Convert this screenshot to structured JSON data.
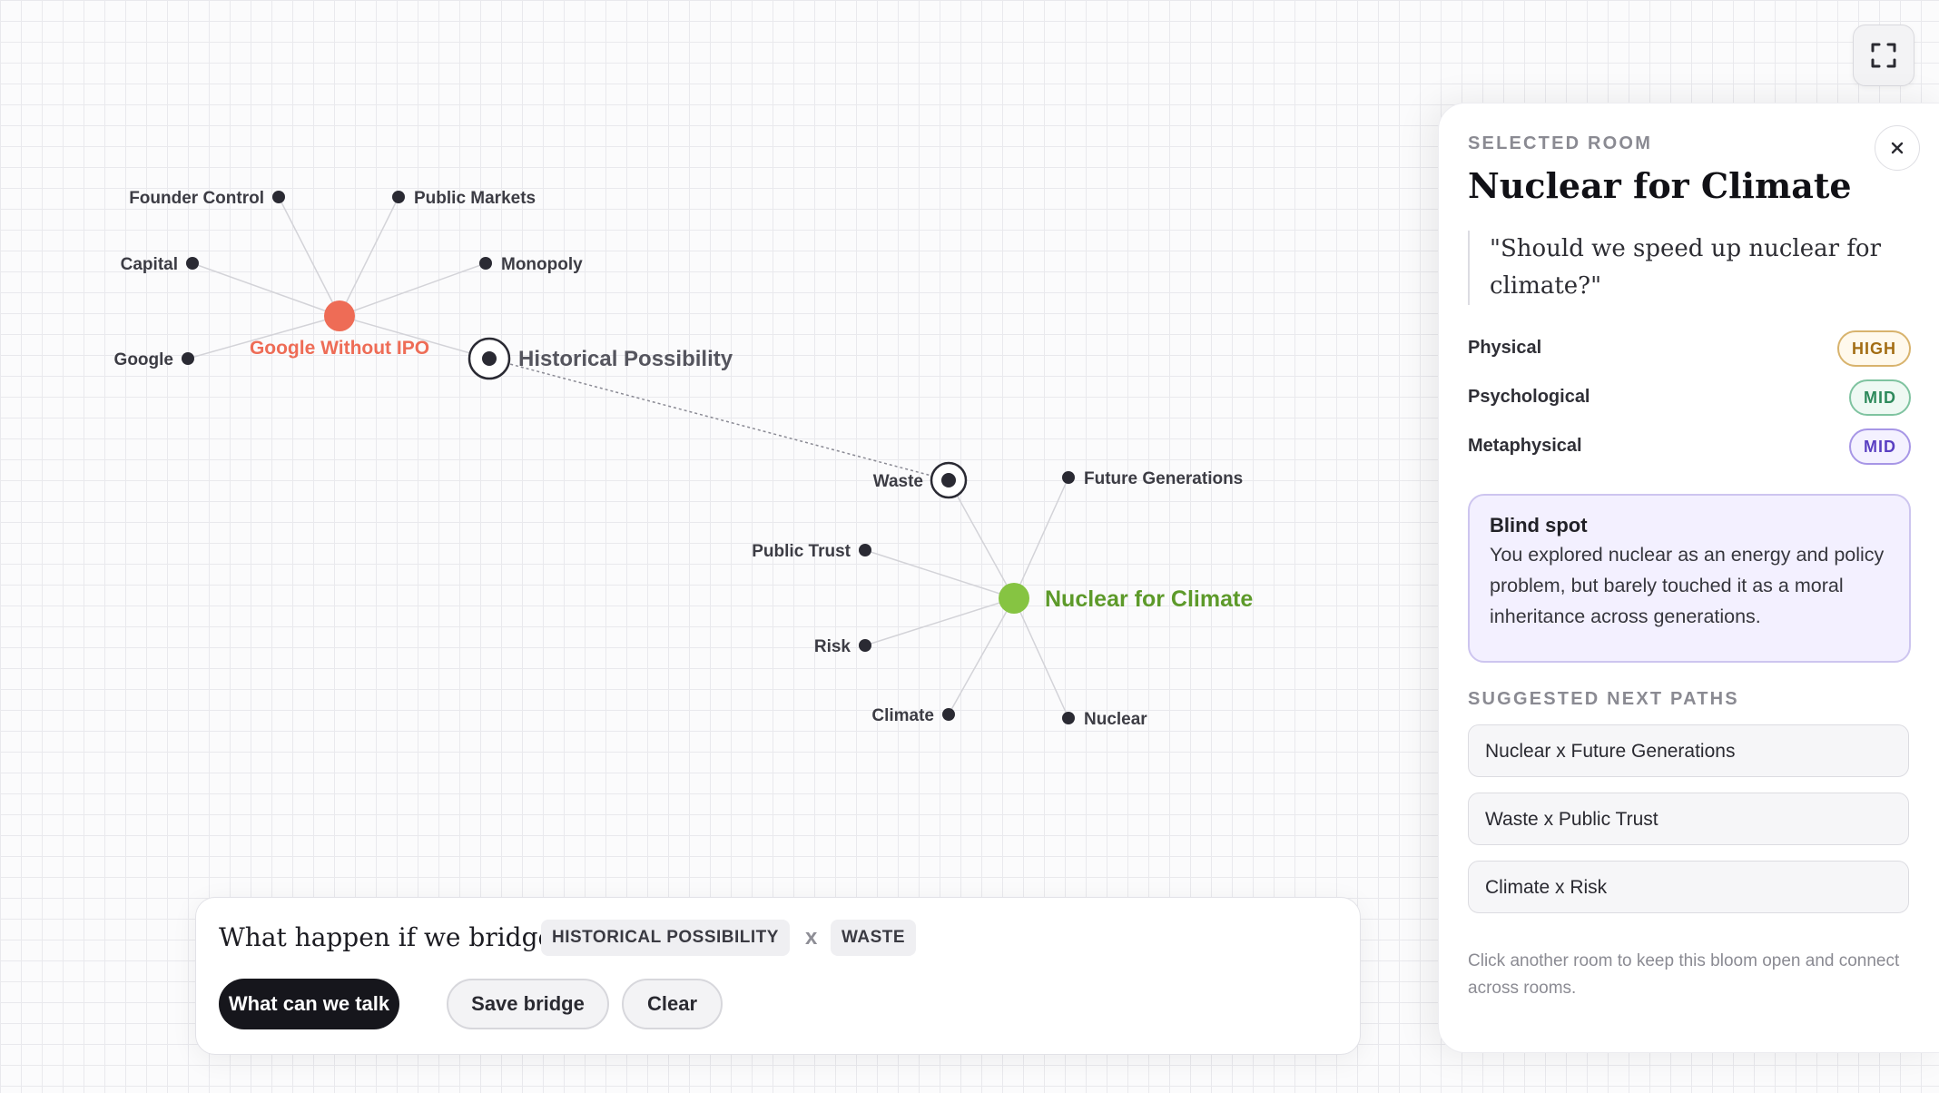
{
  "graph": {
    "colors": {
      "google_room": "#ee6c56",
      "nuclear_room": "#86c442",
      "node": "#2a2a33",
      "edge": "#d3d3d8"
    },
    "google_room": {
      "label": "Google Without IPO",
      "neighbors": [
        "Founder Control",
        "Public Markets",
        "Capital",
        "Monopoly",
        "Google",
        "Historical Possibility"
      ]
    },
    "nuclear_room": {
      "label": "Nuclear for Climate",
      "neighbors": [
        "Waste",
        "Future Generations",
        "Public Trust",
        "Risk",
        "Climate",
        "Nuclear"
      ]
    },
    "bridge_link": [
      "Historical Possibility",
      "Waste"
    ]
  },
  "fullscreen": {
    "icon": "expand-icon"
  },
  "panel": {
    "eyebrow": "SELECTED ROOM",
    "title": "Nuclear for Climate",
    "quote": "\"Should we speed up nuclear for climate?\"",
    "dimensions": [
      {
        "label": "Physical",
        "level": "HIGH"
      },
      {
        "label": "Psychological",
        "level": "MID"
      },
      {
        "label": "Metaphysical",
        "level": "MID"
      }
    ],
    "blind_spot": {
      "title": "Blind spot",
      "text": "You explored nuclear as an energy and policy problem, but barely touched it as a moral inheritance across generations."
    },
    "paths_eyebrow": "SUGGESTED NEXT PATHS",
    "paths": [
      "Nuclear x Future Generations",
      "Waste x Public Trust",
      "Climate x Risk"
    ],
    "footer": "Click another room to keep this bloom open and connect across rooms."
  },
  "bridge": {
    "question": "What happen if we bridge",
    "from": "HISTORICAL POSSIBILITY",
    "times": "x",
    "to": "WASTE",
    "primary": "What can we talk",
    "save": "Save bridge",
    "clear": "Clear"
  }
}
